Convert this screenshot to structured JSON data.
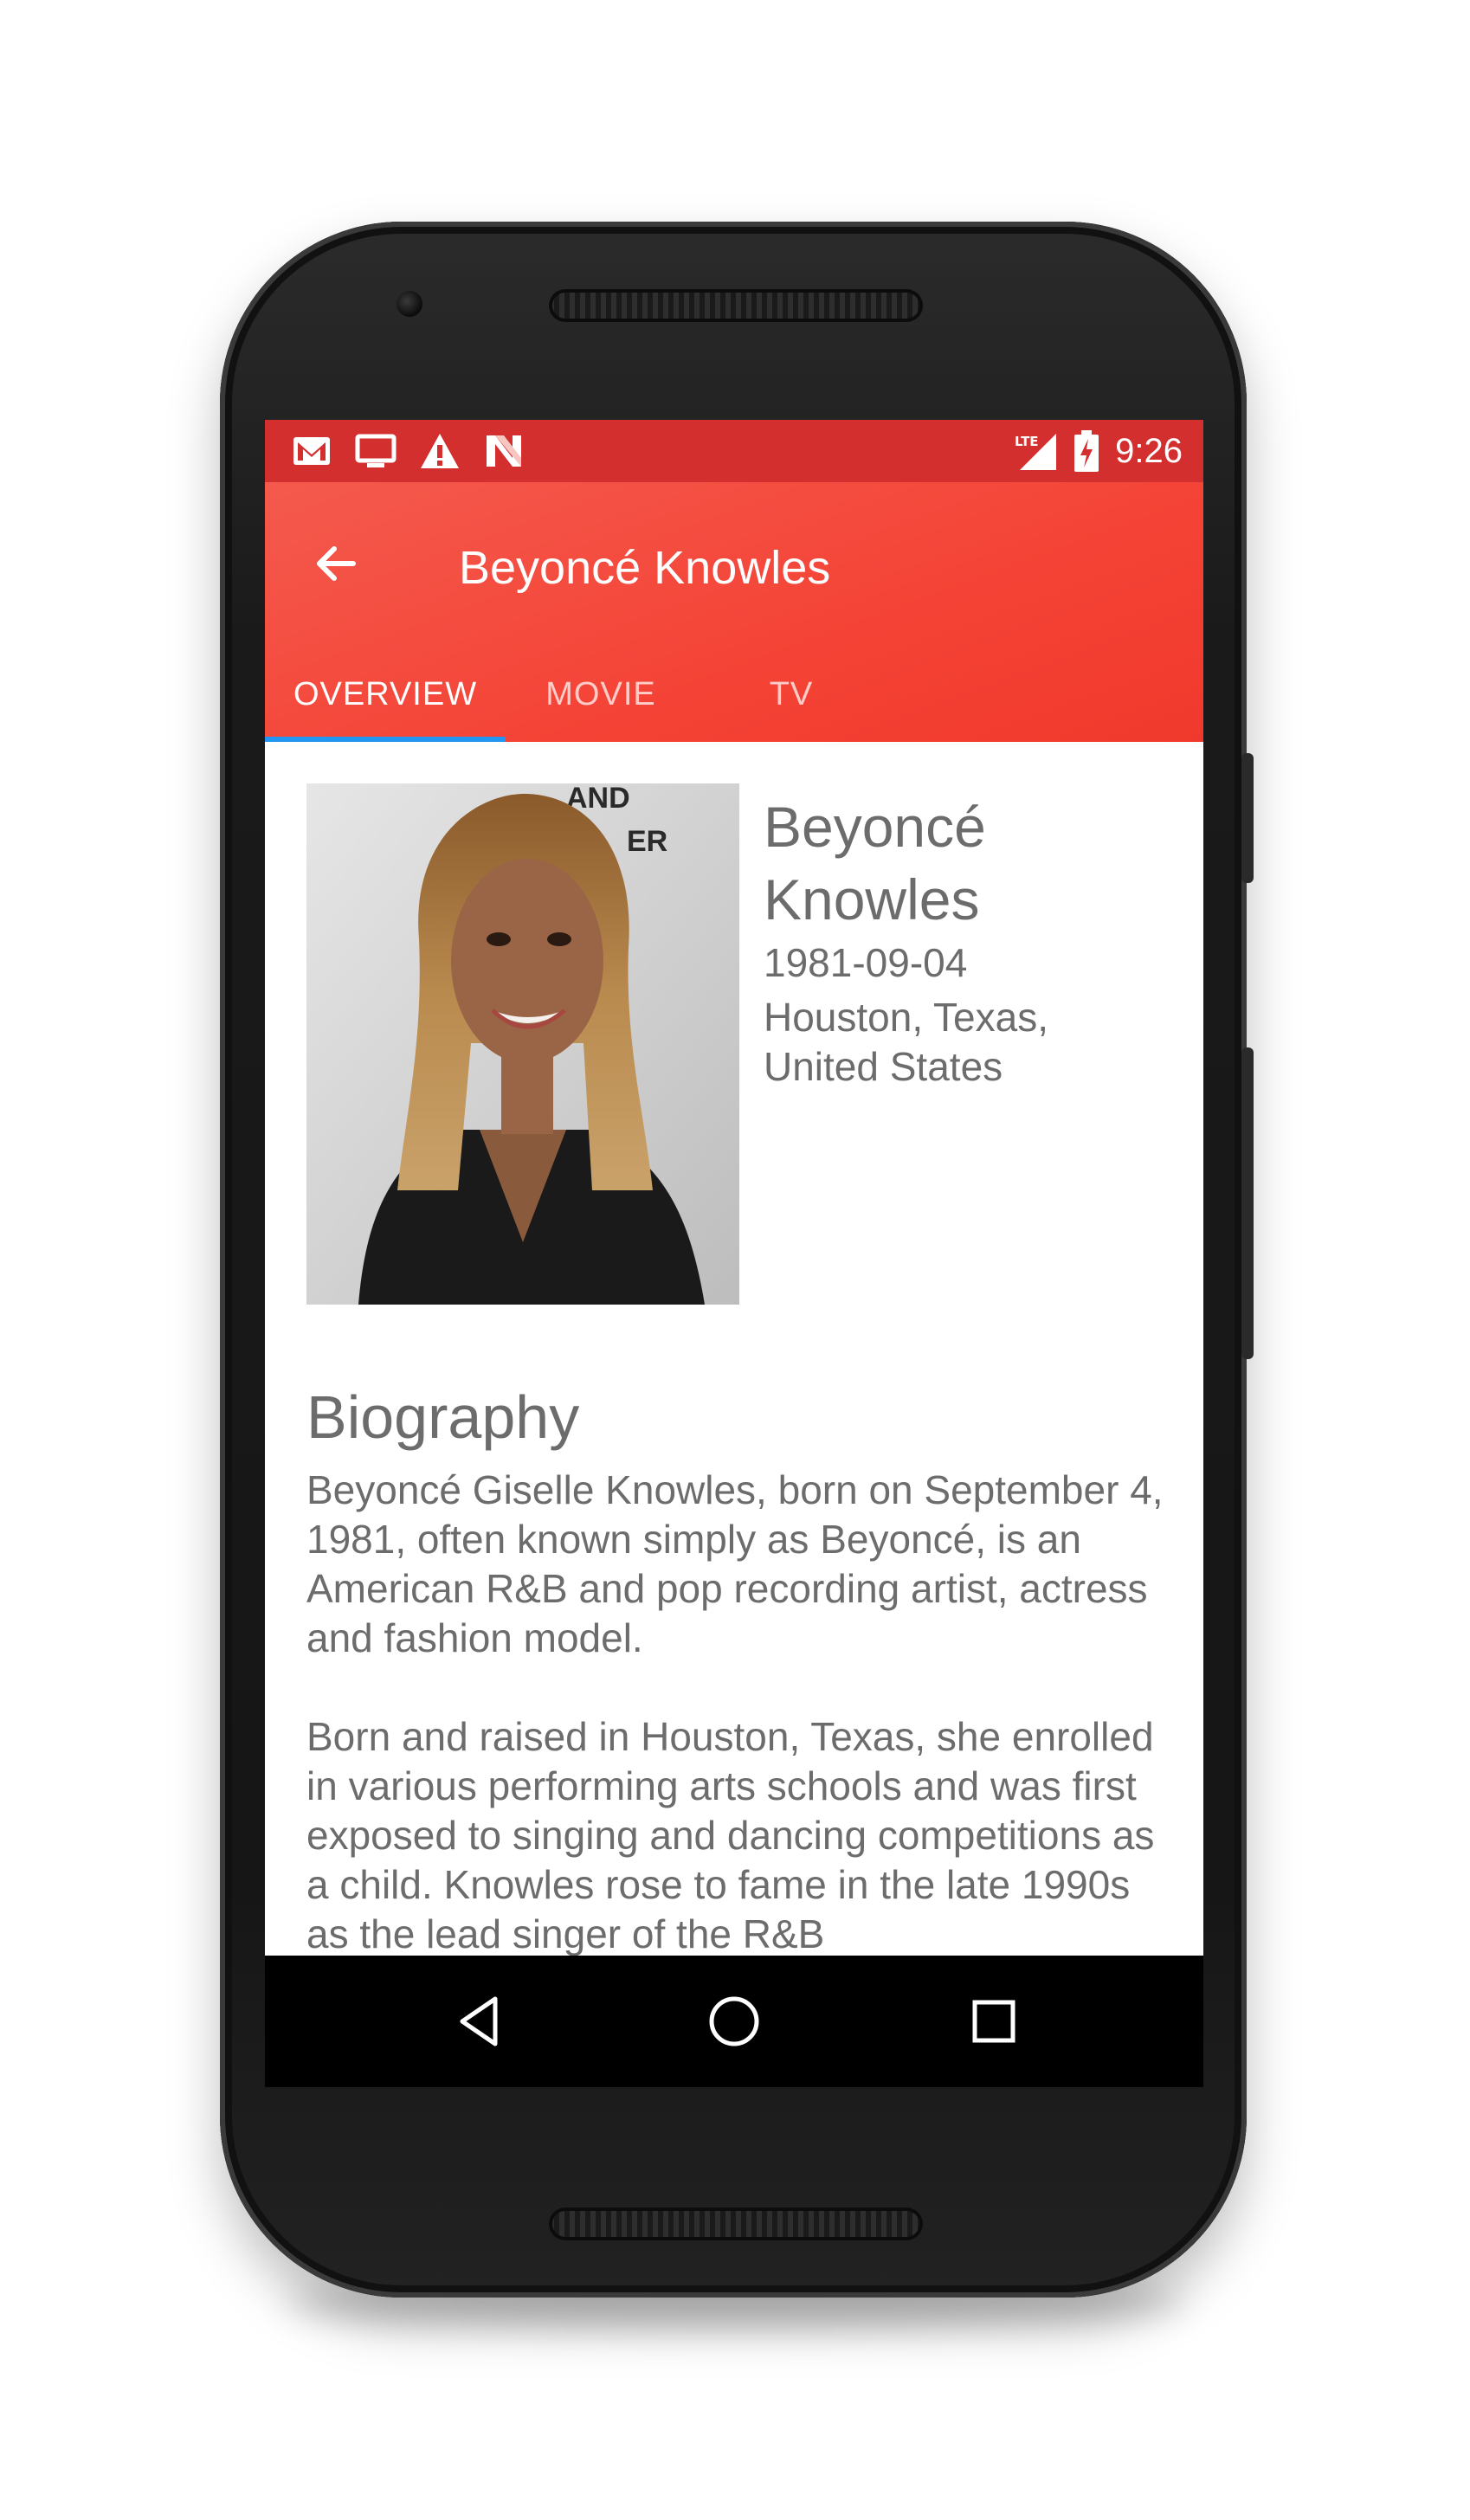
{
  "status_bar": {
    "time": "9:26",
    "network_label": "LTE",
    "left_icons": [
      "gmail-icon",
      "cast-screen-icon",
      "warning-icon",
      "n-app-icon"
    ],
    "right_icons": [
      "lte-signal-icon",
      "battery-charging-icon"
    ]
  },
  "toolbar": {
    "title": "Beyoncé Knowles",
    "back_icon": "arrow-left-icon"
  },
  "tabs": [
    {
      "label": "OVERVIEW",
      "active": true
    },
    {
      "label": "MOVIE",
      "active": false
    },
    {
      "label": "TV",
      "active": false
    }
  ],
  "profile": {
    "name": "Beyoncé Knowles",
    "birthday": "1981-09-04",
    "place_of_birth": "Houston, Texas, United States",
    "photo_backdrop_text": [
      "AND",
      "ER"
    ]
  },
  "biography": {
    "heading": "Biography",
    "paragraphs": [
      "Beyoncé Giselle Knowles, born on September 4, 1981, often known simply as Beyoncé, is an American R&B and pop recording artist, actress and fashion model.",
      "Born and raised in Houston, Texas, she enrolled in various performing arts schools and was first exposed to singing and dancing competitions as a child. Knowles rose to fame in the late 1990s as the lead singer of the R&B"
    ]
  },
  "nav_bar": {
    "back_icon": "triangle-back-icon",
    "home_icon": "circle-home-icon",
    "recents_icon": "square-recents-icon"
  },
  "colors": {
    "status_bar": "#d32f2f",
    "app_bar": "#f44336",
    "tab_indicator": "#2196f3",
    "text_secondary": "#6c6c6c",
    "nav_bar": "#000000"
  }
}
